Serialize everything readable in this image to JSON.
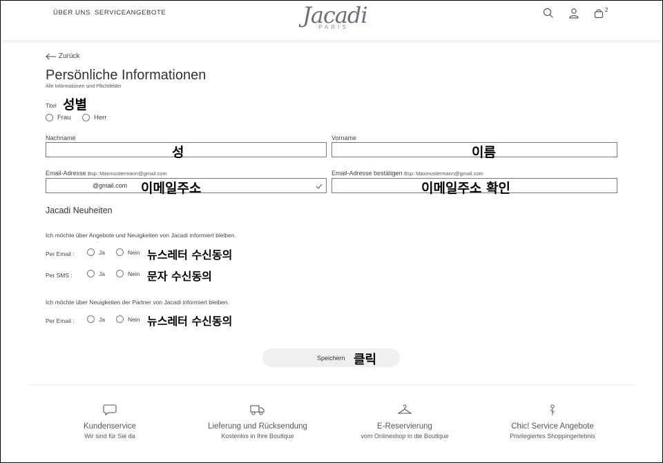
{
  "header": {
    "nav": [
      "ÜBER UNS",
      "SERVICEANGEBOTE"
    ],
    "logo": {
      "main": "Jacadi",
      "sub": "PARIS"
    },
    "icons": [
      "search-icon",
      "user-icon",
      "cart-icon"
    ],
    "cart_count": "2"
  },
  "form": {
    "back_label": "Zurück",
    "title": "Persönliche Informationen",
    "subtitle": "Alle Informationen sind Pflichtfelder",
    "titel_label": "Titel",
    "titel_annotation": "성별",
    "salutations": [
      "Frau",
      "Herr"
    ],
    "nachname_label": "Nachname",
    "nachname_annotation": "성",
    "vorname_label": "Vorname",
    "vorname_annotation": "이름",
    "email_label": "Email-Adresse",
    "email_hint": "Bsp: Maxmustermann@gmail.com",
    "email_value": "@gmail.com",
    "email_annotation": "이메일주소",
    "email_confirm_label": "Email-Adresse bestätigen",
    "email_confirm_hint": "Bsp: Maxmustermann@gmail.com",
    "email_confirm_annotation": "이메일주소 확인"
  },
  "newsletter": {
    "title": "Jacadi Neuheiten",
    "info1": "Ich möchte über Angebote und Neuigkeiten von Jacadi informiert bleiben.",
    "info2": "Ich möchte über Neuigkeiten der Partner von Jacadi informiert bleiben.",
    "rows": [
      {
        "label": "Per Email :",
        "yes": "Ja",
        "no": "Nein",
        "annotation": "뉴스레터 수신동의"
      },
      {
        "label": "Per SMS :",
        "yes": "Ja",
        "no": "Nein",
        "annotation": "문자 수신동의"
      },
      {
        "label": "Per Email :",
        "yes": "Ja",
        "no": "Nein",
        "annotation": "뉴스레터 수신동의"
      }
    ]
  },
  "save": {
    "label": "Speichern",
    "annotation": "클릭"
  },
  "footer": [
    {
      "icon": "chat-bubble-icon",
      "title": "Kundenservice",
      "sub": "Wir sind für Sie da"
    },
    {
      "icon": "truck-icon",
      "title": "Lieferung und Rücksendung",
      "sub": "Kostenlos in Ihre Boutique"
    },
    {
      "icon": "hanger-icon",
      "title": "E-Reservierung",
      "sub": "vom Onlineshop in die Boutique"
    },
    {
      "icon": "flower-icon",
      "title": "Chic! Service Angebote",
      "sub": "Privilegiertes Shoppingerlebnis"
    }
  ]
}
